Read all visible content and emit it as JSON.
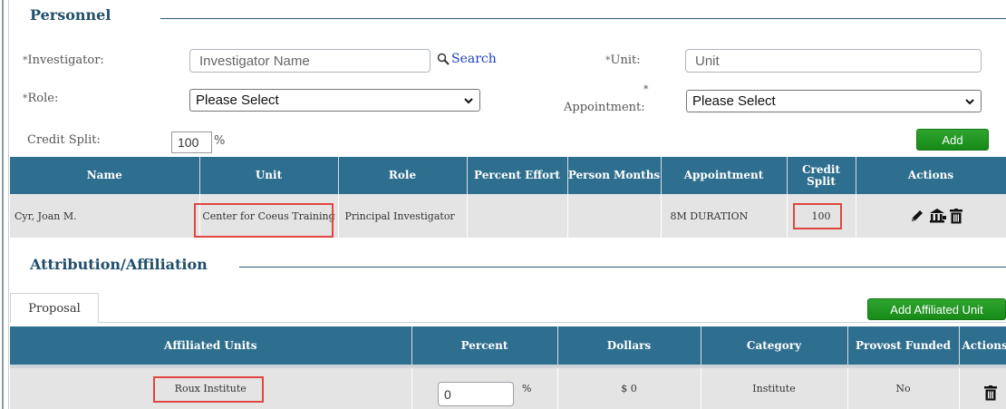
{
  "personnel": {
    "title": "Personnel",
    "investigator_label": "Investigator:",
    "investigator_placeholder": "Investigator Name",
    "search_label": "Search",
    "unit_label": "Unit:",
    "unit_placeholder": "Unit",
    "role_label": "Role:",
    "role_value": "Please Select",
    "appointment_label": "Appointment:",
    "appointment_value": "Please Select",
    "credit_split_label": "Credit Split:",
    "credit_split_value": "100",
    "percent_sign": "%",
    "add_button": "Add",
    "required_marker": "*",
    "table": {
      "headers": [
        "Name",
        "Unit",
        "Role",
        "Percent Effort",
        "Person Months",
        "Appointment",
        "Credit Split",
        "Actions"
      ],
      "rows": [
        {
          "name": "Cyr, Joan M.",
          "unit": "Center for Coeus Training",
          "role": "Principal Investigator",
          "percent_effort": "",
          "person_months": "",
          "appointment": "8M DURATION",
          "credit_split": "100"
        }
      ]
    }
  },
  "attribution": {
    "title": "Attribution/Affiliation",
    "tab_label": "Proposal",
    "add_button": "Add Affiliated Unit",
    "table": {
      "headers": [
        "Affiliated Units",
        "Percent",
        "Dollars",
        "Category",
        "Provost Funded",
        "Actions"
      ],
      "rows": [
        {
          "unit": "Roux Institute",
          "percent": "0",
          "percent_sign": "%",
          "dollars": "$ 0",
          "category": "Institute",
          "provost_funded": "No"
        }
      ]
    }
  },
  "colors": {
    "table_header": "#2e6e8e",
    "row_bg": "#e4e4e4",
    "green_button": "#1e961e",
    "highlight": "#e0463f",
    "section_title": "#1f4e6b"
  }
}
